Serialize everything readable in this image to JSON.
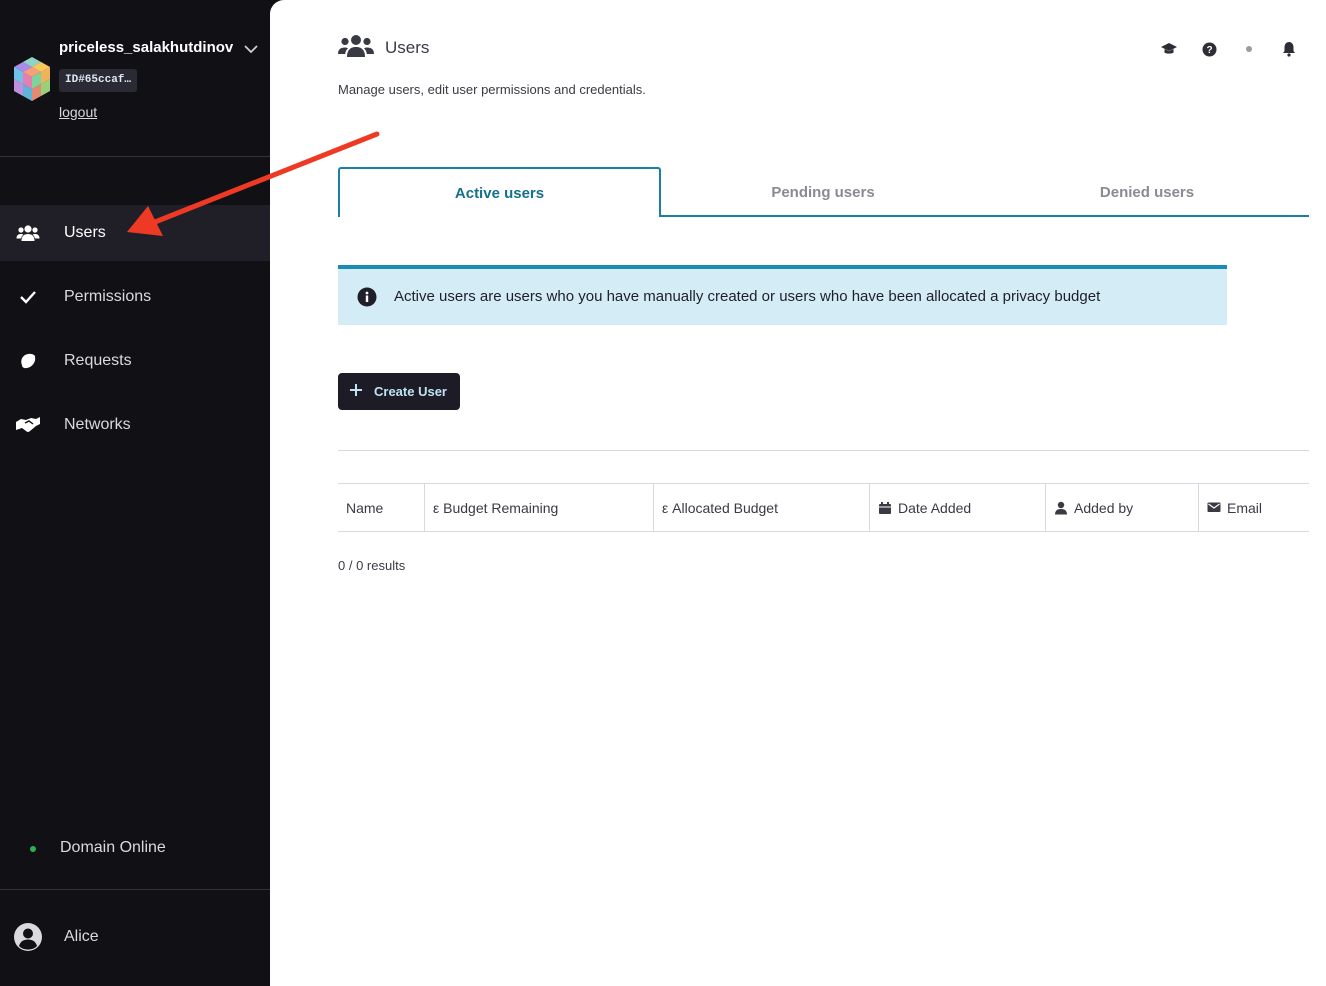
{
  "sidebar": {
    "domain_name": "priceless_salakhutdinov",
    "domain_id": "ID#65ccaf…",
    "logout_label": "logout",
    "nav": [
      {
        "label": "Users",
        "icon": "users-icon",
        "active": true
      },
      {
        "label": "Permissions",
        "icon": "check-icon",
        "active": false
      },
      {
        "label": "Requests",
        "icon": "lemon-icon",
        "active": false
      },
      {
        "label": "Networks",
        "icon": "handshake-icon",
        "active": false
      }
    ],
    "status_label": "Domain Online",
    "status_color": "#2bb24c",
    "user_name": "Alice"
  },
  "header": {
    "title": "Users",
    "subtitle": "Manage users, edit user permissions and credentials.",
    "icons": [
      "graduation-cap-icon",
      "help-icon",
      "dot-icon",
      "bell-icon"
    ]
  },
  "tabs": [
    {
      "label": "Active users",
      "active": true
    },
    {
      "label": "Pending users",
      "active": false
    },
    {
      "label": "Denied users",
      "active": false
    }
  ],
  "info_banner": {
    "text": "Active users are users who you have manually created or users who have been allocated a privacy budget"
  },
  "create_button_label": "Create User",
  "table": {
    "columns": [
      {
        "label": "Name"
      },
      {
        "label": "ε Budget Remaining"
      },
      {
        "label": "ε Allocated Budget"
      },
      {
        "label": "Date Added",
        "icon": "calendar-icon"
      },
      {
        "label": "Added by",
        "icon": "user-icon"
      },
      {
        "label": "Email",
        "icon": "envelope-icon"
      }
    ],
    "results_text": "0 / 0 results"
  },
  "colors": {
    "accent": "#1b7fa3",
    "sidebar_bg": "#111015",
    "annotation_arrow": "#ee3a24"
  }
}
